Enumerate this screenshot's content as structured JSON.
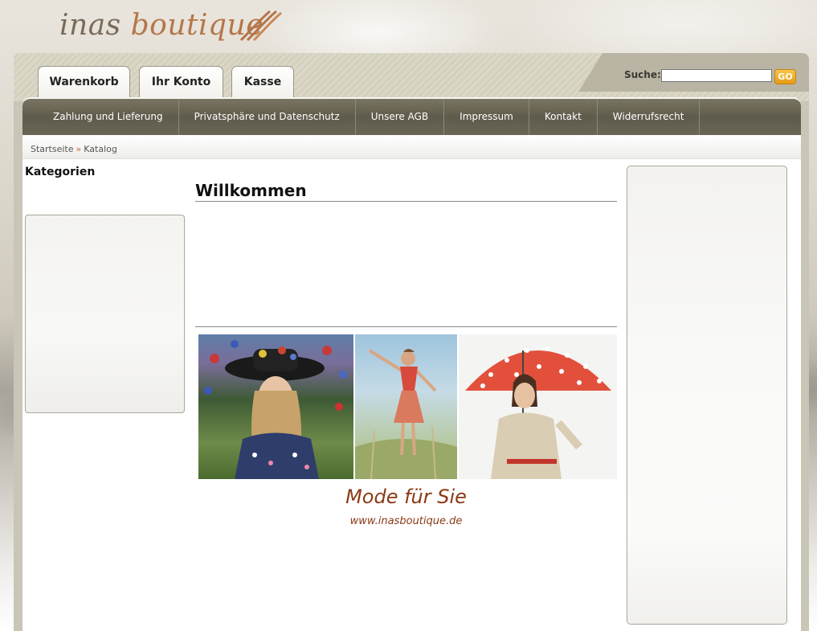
{
  "logo": {
    "word1": "inas",
    "word2": "boutique"
  },
  "tabs": [
    {
      "label": "Warenkorb"
    },
    {
      "label": "Ihr Konto"
    },
    {
      "label": "Kasse"
    }
  ],
  "search": {
    "label": "Suche:",
    "value": "",
    "button": "GO"
  },
  "nav": [
    {
      "label": "Zahlung und Lieferung"
    },
    {
      "label": "Privatsphäre und Datenschutz"
    },
    {
      "label": "Unsere AGB"
    },
    {
      "label": "Impressum"
    },
    {
      "label": "Kontakt"
    },
    {
      "label": "Widerrufsrecht"
    }
  ],
  "breadcrumb": {
    "home": "Startseite",
    "separator": "»",
    "current": "Katalog"
  },
  "sidebar": {
    "title": "Kategorien"
  },
  "main": {
    "heading": "Willkommen",
    "tagline": "Mode für Sie",
    "url": "www.inasboutique.de"
  },
  "colors": {
    "nav_bg": "#66624f",
    "accent_text": "#8b3a16",
    "go_button": "#f0b030",
    "logo_brown": "#b5764a"
  }
}
